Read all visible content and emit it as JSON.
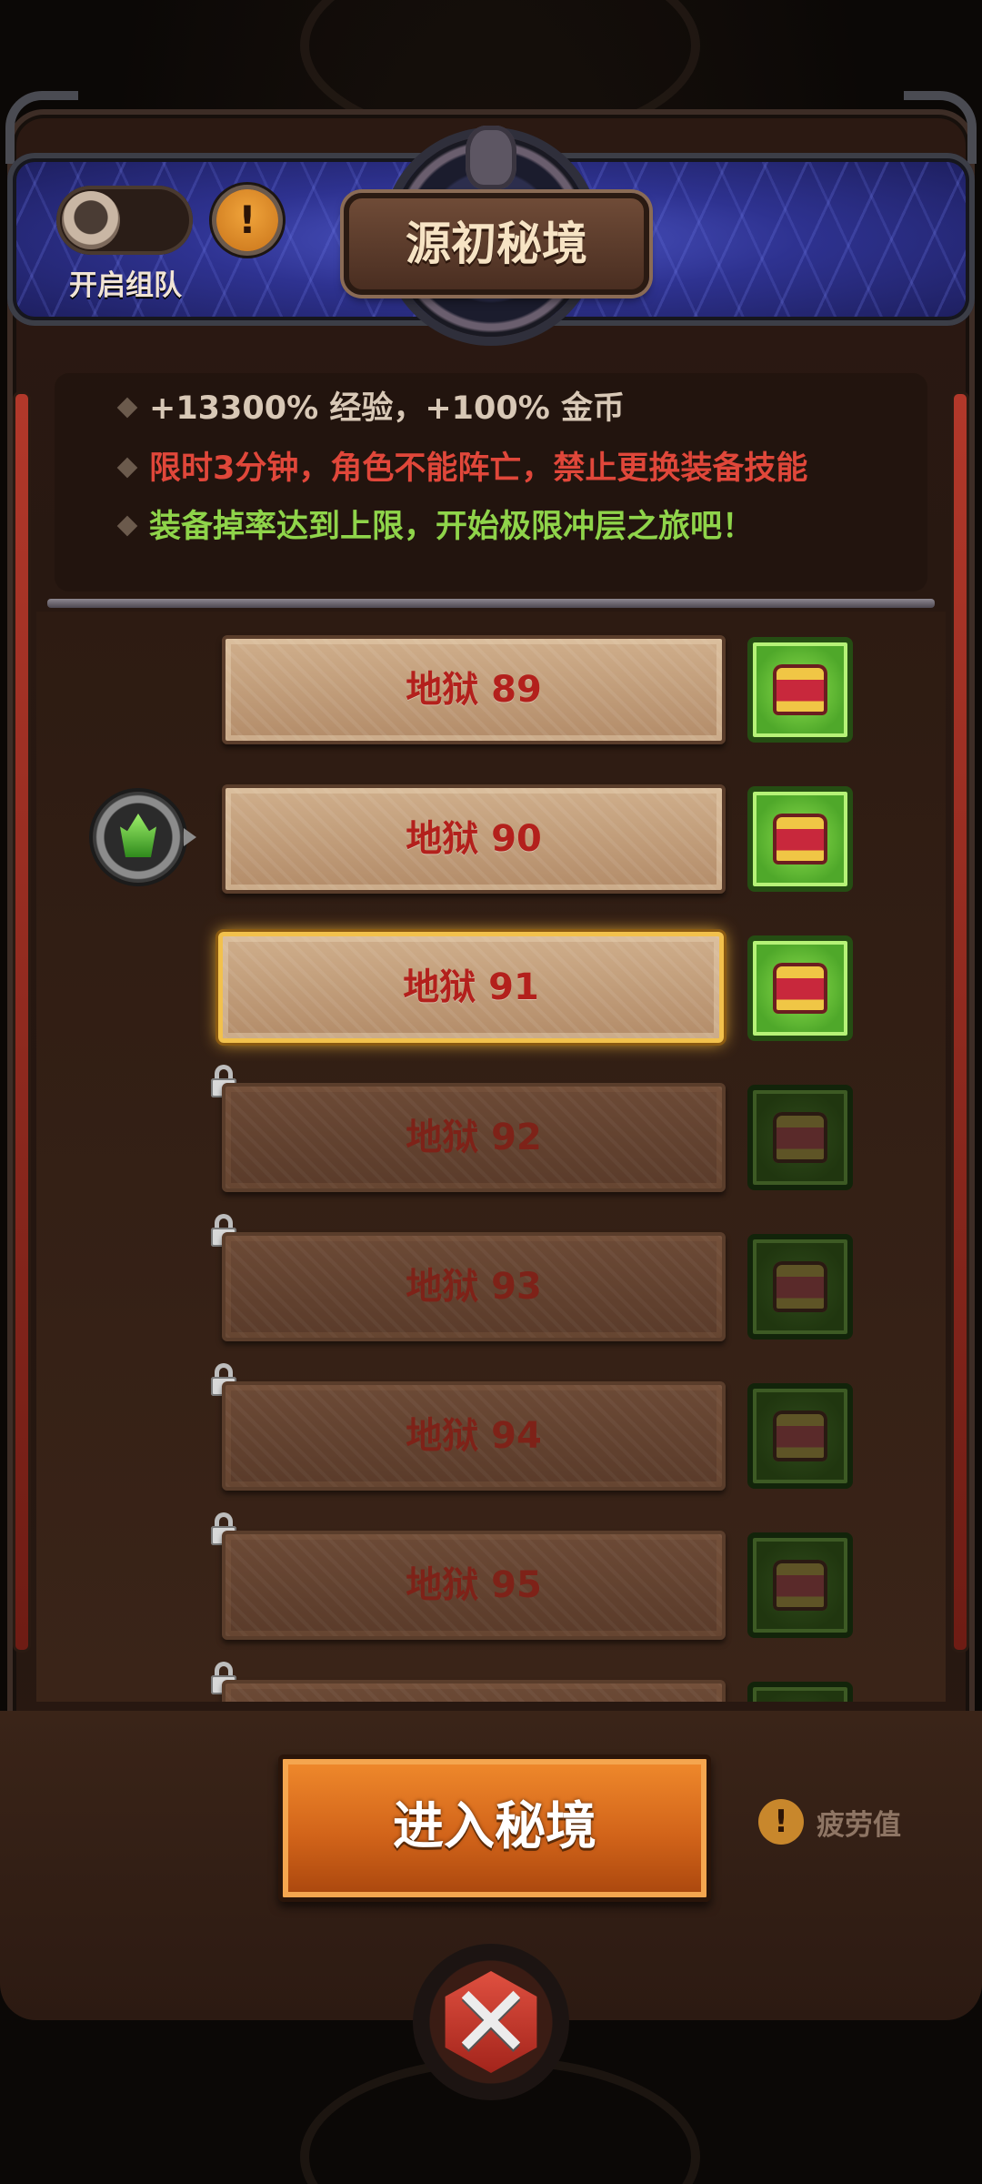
{
  "header": {
    "title": "源初秘境",
    "team_toggle_label": "开启组队",
    "info_icon": "!"
  },
  "info": {
    "lines": [
      {
        "text": "+13300% 经验，+100% 金币",
        "color": "#d8c8b6"
      },
      {
        "text": "限时3分钟，角色不能阵亡，禁止更换装备技能",
        "color": "#e0473a"
      },
      {
        "text": "装备掉率达到上限，开始极限冲层之旅吧！",
        "color": "#8fd44a"
      }
    ]
  },
  "levels": [
    {
      "label": "地狱 89",
      "state": "unlocked"
    },
    {
      "label": "地狱 90",
      "state": "current"
    },
    {
      "label": "地狱 91",
      "state": "selected"
    },
    {
      "label": "地狱 92",
      "state": "locked"
    },
    {
      "label": "地狱 93",
      "state": "locked"
    },
    {
      "label": "地狱 94",
      "state": "locked"
    },
    {
      "label": "地狱 95",
      "state": "locked"
    }
  ],
  "actions": {
    "enter_label": "进入秘境",
    "fatigue_icon": "!",
    "fatigue_label": "疲劳值",
    "close_icon": "✕"
  },
  "colors": {
    "accent_orange": "#d2641a",
    "level_text_red": "#b3201c",
    "reward_green": "#8ee04d",
    "selected_gold": "#f2c14c"
  },
  "icons": {
    "team_toggle": "toggle-off-icon",
    "info": "exclamation-icon",
    "current_level_marker": "green-gem-icon",
    "reward": "treasure-chest-icon",
    "lock": "lock-icon",
    "fatigue": "exclamation-icon",
    "close": "close-icon"
  }
}
